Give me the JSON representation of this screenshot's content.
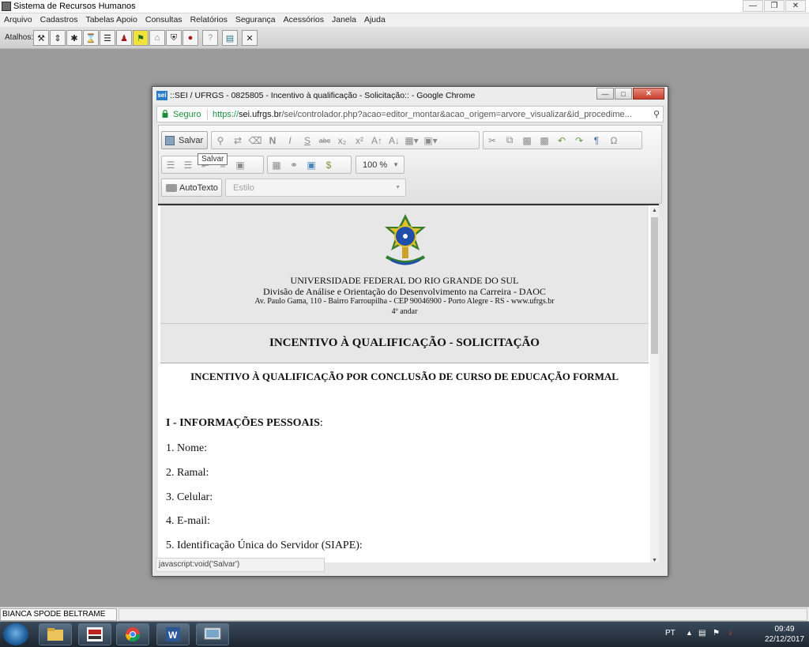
{
  "app": {
    "title": "Sistema de Recursos Humanos",
    "window_buttons": [
      "minimize",
      "restore",
      "close"
    ]
  },
  "menubar": {
    "items": [
      "Arquivo",
      "Cadastros",
      "Tabelas Apoio",
      "Consultas",
      "Relatórios",
      "Segurança",
      "Acessórios",
      "Janela",
      "Ajuda"
    ]
  },
  "shortcuts": {
    "label": "Atalhos:",
    "buttons": [
      "tools-icon",
      "syringe-icon",
      "bug-icon",
      "hourglass-icon",
      "list-icon",
      "people-icon",
      "running-person-icon",
      "house-icon",
      "shield-icon",
      "car-icon",
      "help-icon",
      "exit-door-icon",
      "close-icon"
    ]
  },
  "chrome": {
    "title": "::SEI / UFRGS - 0825805 - Incentivo à qualificação - Solicitação:: - Google Chrome",
    "secure_label": "Seguro",
    "url_prefix": "https://",
    "url_domain": "sei.ufrgs.br",
    "url_path": "/sei/controlador.php?acao=editor_montar&acao_origem=arvore_visualizar&id_procedime...",
    "status_text": "javascript:void('Salvar')"
  },
  "editor": {
    "save_label": "Salvar",
    "tooltip": "Salvar",
    "zoom": "100 %",
    "autotexto_label": "AutoTexto",
    "estilo_placeholder": "Estilo"
  },
  "document": {
    "institution": "UNIVERSIDADE FEDERAL DO RIO GRANDE DO SUL",
    "division": "Divisão de Análise e Orientação do Desenvolvimento na Carreira - DAOC",
    "address": "Av. Paulo Gama, 110 - Bairro Farroupilha - CEP 90046900 - Porto Alegre - RS - www.ufrgs.br",
    "floor": "4º andar",
    "title": "INCENTIVO À QUALIFICAÇÃO - SOLICITAÇÃO",
    "subtitle": "INCENTIVO À QUALIFICAÇÃO POR CONCLUSÃO DE CURSO DE EDUCAÇÃO FORMAL",
    "section_title": "I - INFORMAÇÕES PESSOAIS",
    "section_colon": ":",
    "fields": [
      "1. Nome:",
      "2. Ramal:",
      "3. Celular:",
      "4. E-mail:",
      "5. Identificação Única do Servidor (SIAPE):"
    ]
  },
  "statusbar": {
    "user": "BIANCA SPODE BELTRAME"
  },
  "taskbar": {
    "apps": [
      "folder-icon",
      "ufrgs-app-icon",
      "chrome-icon",
      "word-icon",
      "screen-icon"
    ],
    "language": "PT",
    "time": "09:49",
    "date": "22/12/2017"
  },
  "colors": {
    "secure_green": "#1e8e3e",
    "close_red": "#c9412e",
    "desktop_gray": "#9b9b9b"
  }
}
